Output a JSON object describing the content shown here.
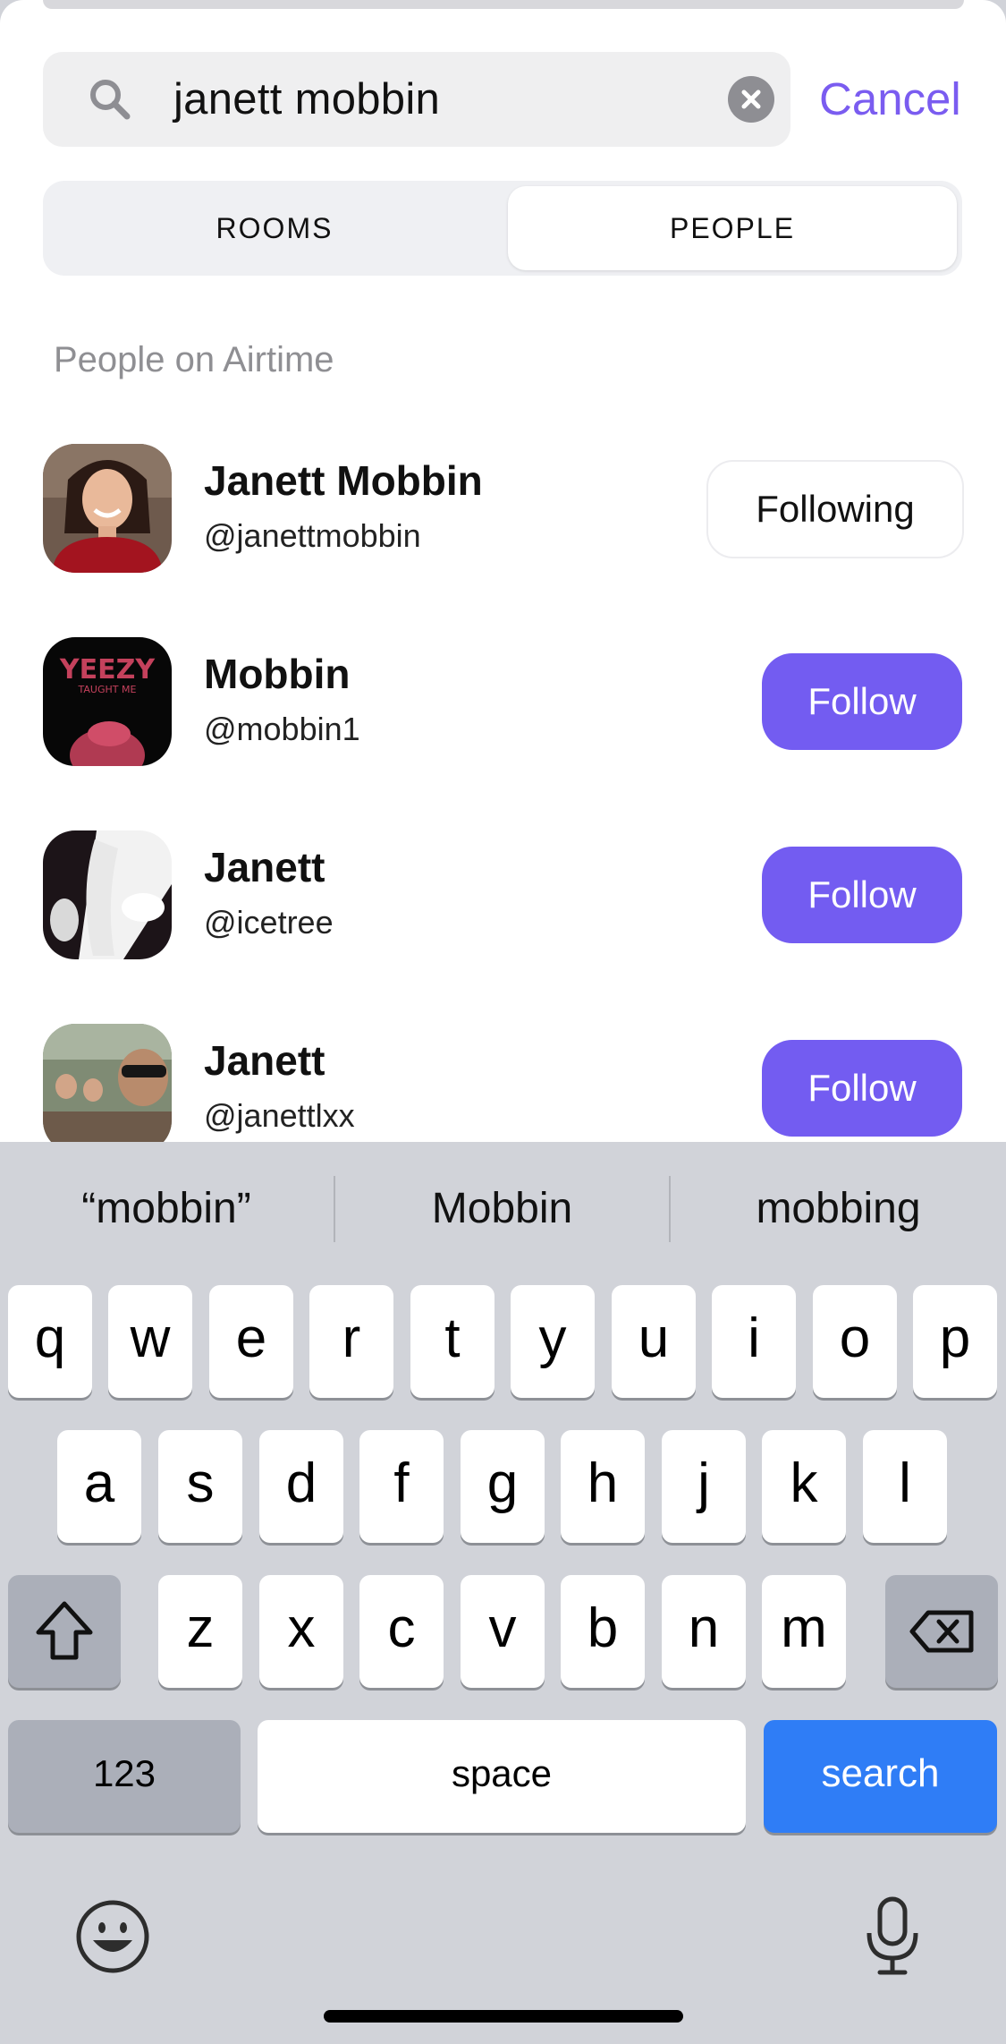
{
  "search": {
    "query": "janett mobbin",
    "cancel_label": "Cancel"
  },
  "tabs": [
    {
      "label": "ROOMS",
      "selected": false
    },
    {
      "label": "PEOPLE",
      "selected": true
    }
  ],
  "section_title": "People on Airtime",
  "people": [
    {
      "name": "Janett Mobbin",
      "handle": "@janettmobbin",
      "action": "Following"
    },
    {
      "name": "Mobbin",
      "handle": "@mobbin1",
      "action": "Follow"
    },
    {
      "name": "Janett",
      "handle": "@icetree",
      "action": "Follow"
    },
    {
      "name": "Janett",
      "handle": "@janettlxx",
      "action": "Follow"
    }
  ],
  "keyboard": {
    "suggestions": [
      "“mobbin”",
      "Mobbin",
      "mobbing"
    ],
    "row1": [
      "q",
      "w",
      "e",
      "r",
      "t",
      "y",
      "u",
      "i",
      "o",
      "p"
    ],
    "row2": [
      "a",
      "s",
      "d",
      "f",
      "g",
      "h",
      "j",
      "k",
      "l"
    ],
    "row3": [
      "z",
      "x",
      "c",
      "v",
      "b",
      "n",
      "m"
    ],
    "numbers_label": "123",
    "space_label": "space",
    "search_label": "search",
    "icons": [
      "shift-icon",
      "backspace-icon",
      "emoji-icon",
      "microphone-icon"
    ]
  },
  "colors": {
    "accent": "#735cf1",
    "keyboard_search": "#2f7df6"
  }
}
